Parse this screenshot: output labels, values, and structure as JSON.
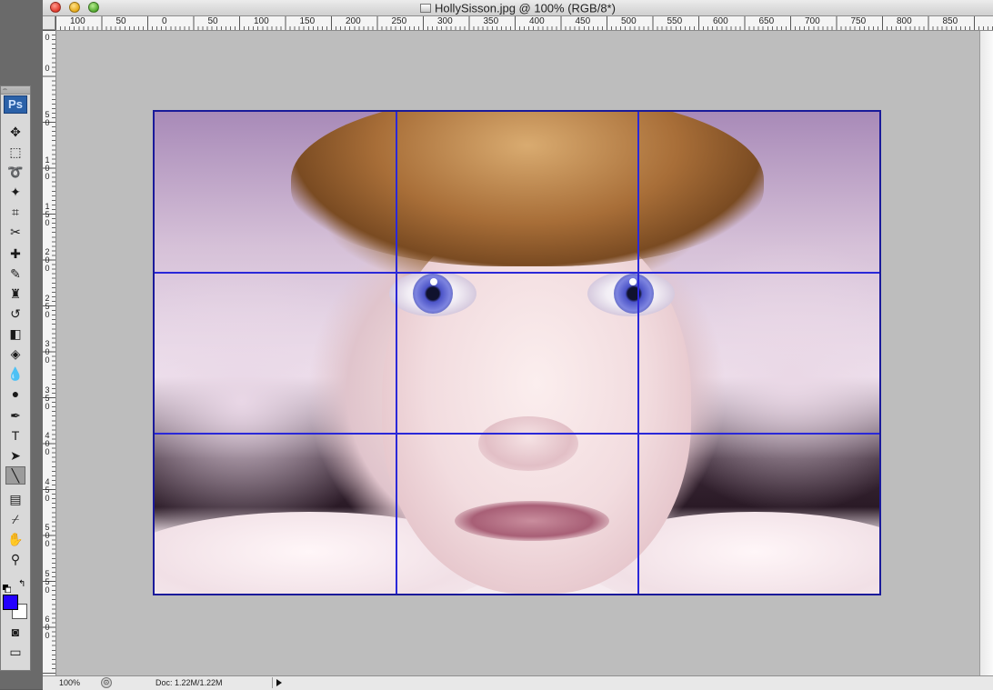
{
  "window": {
    "title": "HollySisson.jpg @ 100% (RGB/8*)"
  },
  "toolbox": {
    "logo": "Ps",
    "tools": [
      {
        "name": "move-tool",
        "glyph": "✥"
      },
      {
        "name": "marquee-tool",
        "glyph": "⬚"
      },
      {
        "name": "lasso-tool",
        "glyph": "➰"
      },
      {
        "name": "magic-wand-tool",
        "glyph": "✦"
      },
      {
        "name": "crop-tool",
        "glyph": "⌗"
      },
      {
        "name": "slice-tool",
        "glyph": "✂"
      },
      {
        "name": "healing-brush-tool",
        "glyph": "✚"
      },
      {
        "name": "brush-tool",
        "glyph": "✎"
      },
      {
        "name": "clone-stamp-tool",
        "glyph": "♜"
      },
      {
        "name": "history-brush-tool",
        "glyph": "↺"
      },
      {
        "name": "eraser-tool",
        "glyph": "◧"
      },
      {
        "name": "paint-bucket-tool",
        "glyph": "◈"
      },
      {
        "name": "blur-tool",
        "glyph": "💧"
      },
      {
        "name": "dodge-tool",
        "glyph": "●"
      },
      {
        "name": "pen-tool",
        "glyph": "✒"
      },
      {
        "name": "type-tool",
        "glyph": "T"
      },
      {
        "name": "path-selection-tool",
        "glyph": "➤"
      },
      {
        "name": "line-tool",
        "glyph": "╲"
      },
      {
        "name": "notes-tool",
        "glyph": "▤"
      },
      {
        "name": "eyedropper-tool",
        "glyph": "⌿"
      },
      {
        "name": "hand-tool",
        "glyph": "✋"
      },
      {
        "name": "zoom-tool",
        "glyph": "⚲"
      },
      {
        "name": "quick-mask-tool",
        "glyph": "◙"
      },
      {
        "name": "screen-mode-tool",
        "glyph": "▭"
      }
    ],
    "active_tool": "line-tool",
    "foreground_color": "#2400ff",
    "background_color": "#ffffff"
  },
  "ruler_h": {
    "labels": [
      "100",
      "50",
      "0",
      "50",
      "100",
      "150",
      "200",
      "250",
      "300",
      "350",
      "400",
      "450",
      "500",
      "550",
      "600",
      "650",
      "700",
      "750",
      "800",
      "850"
    ]
  },
  "ruler_v": {
    "labels": [
      "0",
      "0",
      "5\n0",
      "1\n0\n0",
      "1\n5\n0",
      "2\n0\n0",
      "2\n5\n0",
      "3\n0\n0",
      "3\n5\n0",
      "4\n0\n0",
      "4\n5\n0",
      "5\n0\n0",
      "5\n5\n0",
      "6\n0\n0"
    ]
  },
  "document": {
    "grid_color": "#2a28d8",
    "guides": "rule-of-thirds"
  },
  "statusbar": {
    "zoom": "100%",
    "doc_info": "Doc: 1.22M/1.22M"
  }
}
